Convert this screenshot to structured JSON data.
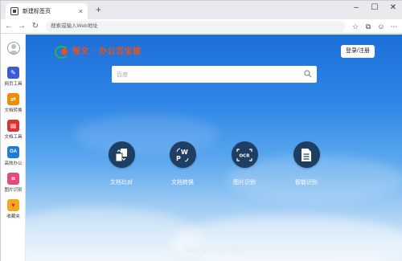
{
  "browser": {
    "tab_title": "新建标签页",
    "tab_close": "×",
    "new_tab": "+",
    "address_placeholder": "搜索或输入Web地址",
    "window_controls": [
      "–",
      "☐",
      "✕"
    ]
  },
  "sidebar": {
    "items": [
      {
        "label": "网页工具",
        "icon": "wrench-icon",
        "color": "#3b5bdb",
        "glyph": "✎"
      },
      {
        "label": "文档转换",
        "icon": "document-convert-icon",
        "color": "#f08c00",
        "glyph": "⇄"
      },
      {
        "label": "文档工具",
        "icon": "toolbox-icon",
        "color": "#e03131",
        "glyph": "▤"
      },
      {
        "label": "高效办公",
        "icon": "office-icon",
        "color": "#1c7ed6",
        "glyph": "OA"
      },
      {
        "label": "图片识别",
        "icon": "image-scan-icon",
        "color": "#e64980",
        "glyph": "⌗"
      },
      {
        "label": "收藏夹",
        "icon": "favorites-folder-icon",
        "color": "#f5a623",
        "glyph": "♥"
      }
    ]
  },
  "main": {
    "logo_text": "智文 · 办公百宝箱",
    "login_label": "登录/注册",
    "search_placeholder": "百度",
    "tools": [
      {
        "label": "文档比对",
        "icon": "compare-icon"
      },
      {
        "label": "文档转换",
        "icon": "wp-convert-icon"
      },
      {
        "label": "图片识别",
        "icon": "ocr-icon"
      },
      {
        "label": "智能识别",
        "icon": "smart-doc-icon"
      }
    ],
    "footer": "商务合作: 17092772066"
  },
  "colors": {
    "accent": "#1e3f63",
    "logo": "#e7511e",
    "background_top": "#1d6fd8"
  }
}
